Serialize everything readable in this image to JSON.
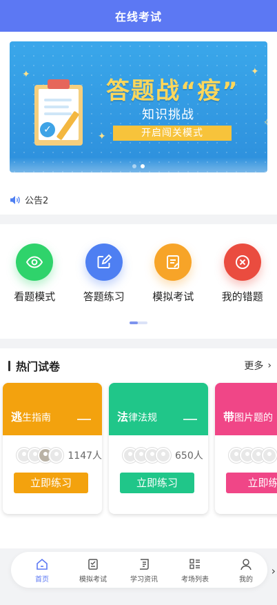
{
  "header": {
    "title": "在线考试"
  },
  "banner": {
    "title": "答题战“疫”",
    "subtitle": "知识挑战",
    "button": "开启闯关模式",
    "colors": {
      "bg": "#2d8fdc",
      "accent": "#f7c33b"
    }
  },
  "notice": {
    "icon": "speaker-icon",
    "text": "公告2"
  },
  "entries": [
    {
      "label": "看题模式",
      "icon": "eye-icon",
      "color": "#2fd36b"
    },
    {
      "label": "答题练习",
      "icon": "edit-icon",
      "color": "#4e7ff2"
    },
    {
      "label": "模拟考试",
      "icon": "exam-doc-icon",
      "color": "#f7a428"
    },
    {
      "label": "我的错题",
      "icon": "close-circle-icon",
      "color": "#ea4c3f"
    }
  ],
  "hot": {
    "title": "热门试卷",
    "more": "更多",
    "cards": [
      {
        "name_big": "逃",
        "name_rest": "生指南",
        "count": "1147人",
        "button": "立即练习",
        "color": "#f3a20e"
      },
      {
        "name_big": "法",
        "name_rest": "律法规",
        "count": "650人",
        "button": "立即练习",
        "color": "#20c689"
      },
      {
        "name_big": "带",
        "name_rest": "图片题的",
        "count": "",
        "button": "立即练",
        "color": "#f04687"
      }
    ]
  },
  "tabbar": {
    "items": [
      {
        "label": "首页",
        "icon": "home-icon",
        "active": true
      },
      {
        "label": "模拟考试",
        "icon": "exam-icon"
      },
      {
        "label": "学习资讯",
        "icon": "news-icon"
      },
      {
        "label": "考场列表",
        "icon": "list-icon"
      },
      {
        "label": "我的",
        "icon": "user-icon"
      }
    ],
    "accent": "#5c78f3"
  }
}
